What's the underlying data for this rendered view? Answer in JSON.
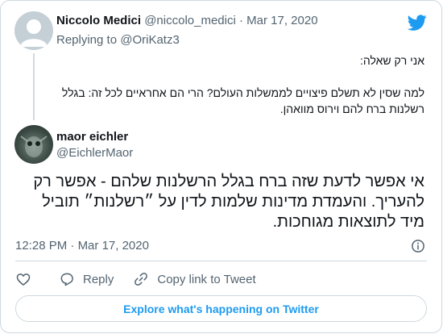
{
  "colors": {
    "accent": "#1d9bf0",
    "text": "#0f1419",
    "muted": "#536471",
    "border": "#cfd9de"
  },
  "quoted": {
    "name": "Niccolo Medici",
    "handle": "@niccolo_medici",
    "separator": "·",
    "date": "Mar 17, 2020",
    "replying_prefix": "Replying to",
    "replying_to": "@OriKatz3",
    "lines": [
      "אני רק שאלה:",
      "למה שסין לא תשלם פיצויים לממשלות העולם? הרי הם אחראיים לכל זה: בגלל רשלנות ברח להם וירוס מוואהן."
    ]
  },
  "tweet": {
    "name": "maor eichler",
    "handle": "@EichlerMaor",
    "text": "אי אפשר לדעת שזה ברח בגלל הרשלנות שלהם - אפשר רק להעריך. והעמדת מדינות  שלמות לדין על ״רשלנות״ תוביל מיד לתוצאות מגוחכות.",
    "time": "12:28 PM",
    "separator": "·",
    "date": "Mar 17, 2020"
  },
  "actions": {
    "reply_label": "Reply",
    "copy_label": "Copy link to Tweet"
  },
  "explore_label": "Explore what's happening on Twitter",
  "icons": [
    "twitter-bird-icon",
    "info-icon",
    "heart-icon",
    "reply-icon",
    "link-icon"
  ]
}
